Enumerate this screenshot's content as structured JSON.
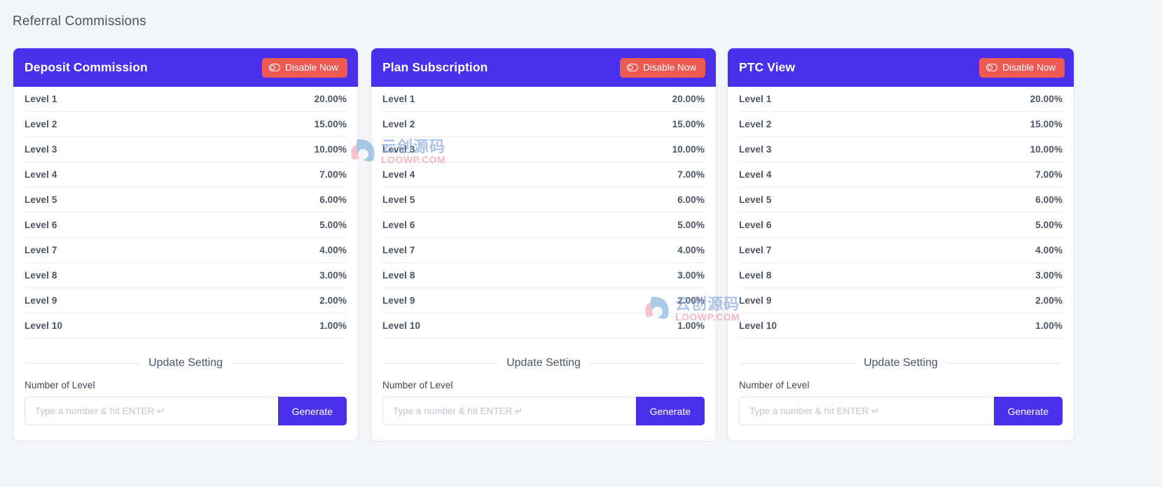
{
  "page": {
    "title": "Referral Commissions",
    "background_color": "#f4f5f9"
  },
  "theme": {
    "header_purple": "#4a30ec",
    "disable_red": "#ee5a52",
    "text_dark": "#4c5564",
    "generate_blue": "#4a30ec"
  },
  "common": {
    "disable_label": "Disable Now",
    "disable_icon": "toggle-off-icon",
    "update_setting_label": "Update Setting",
    "number_of_level_label": "Number of Level",
    "input_placeholder": "Type a number & hit ENTER ↵",
    "input_value": "",
    "generate_label": "Generate"
  },
  "cards": [
    {
      "title": "Deposit Commission",
      "levels": [
        {
          "name": "Level 1",
          "value": "20.00%"
        },
        {
          "name": "Level 2",
          "value": "15.00%"
        },
        {
          "name": "Level 3",
          "value": "10.00%"
        },
        {
          "name": "Level 4",
          "value": "7.00%"
        },
        {
          "name": "Level 5",
          "value": "6.00%"
        },
        {
          "name": "Level 6",
          "value": "5.00%"
        },
        {
          "name": "Level 7",
          "value": "4.00%"
        },
        {
          "name": "Level 8",
          "value": "3.00%"
        },
        {
          "name": "Level 9",
          "value": "2.00%"
        },
        {
          "name": "Level 10",
          "value": "1.00%"
        }
      ]
    },
    {
      "title": "Plan Subscription",
      "levels": [
        {
          "name": "Level 1",
          "value": "20.00%"
        },
        {
          "name": "Level 2",
          "value": "15.00%"
        },
        {
          "name": "Level 3",
          "value": "10.00%"
        },
        {
          "name": "Level 4",
          "value": "7.00%"
        },
        {
          "name": "Level 5",
          "value": "6.00%"
        },
        {
          "name": "Level 6",
          "value": "5.00%"
        },
        {
          "name": "Level 7",
          "value": "4.00%"
        },
        {
          "name": "Level 8",
          "value": "3.00%"
        },
        {
          "name": "Level 9",
          "value": "2.00%"
        },
        {
          "name": "Level 10",
          "value": "1.00%"
        }
      ]
    },
    {
      "title": "PTC View",
      "levels": [
        {
          "name": "Level 1",
          "value": "20.00%"
        },
        {
          "name": "Level 2",
          "value": "15.00%"
        },
        {
          "name": "Level 3",
          "value": "10.00%"
        },
        {
          "name": "Level 4",
          "value": "7.00%"
        },
        {
          "name": "Level 5",
          "value": "6.00%"
        },
        {
          "name": "Level 6",
          "value": "5.00%"
        },
        {
          "name": "Level 7",
          "value": "4.00%"
        },
        {
          "name": "Level 8",
          "value": "3.00%"
        },
        {
          "name": "Level 9",
          "value": "2.00%"
        },
        {
          "name": "Level 10",
          "value": "1.00%"
        }
      ]
    }
  ],
  "watermarks": [
    {
      "cn": "云创源码",
      "en": "LOOWP.COM"
    },
    {
      "cn": "云创源码",
      "en": "LOOWP.COM"
    }
  ]
}
